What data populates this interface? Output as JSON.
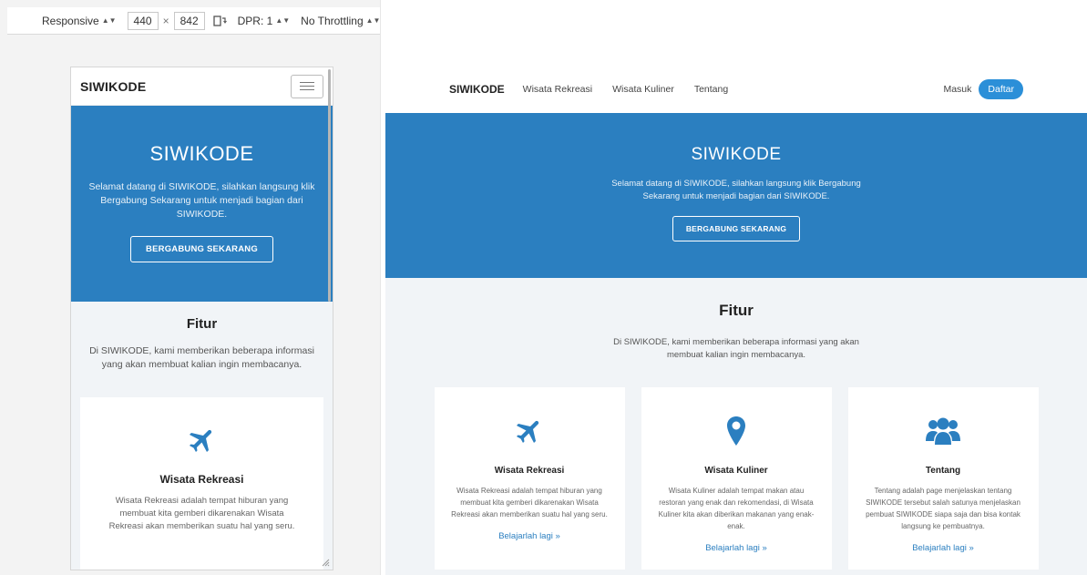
{
  "devtools": {
    "device": "Responsive",
    "width": "440",
    "times": "×",
    "height": "842",
    "dpr_label": "DPR: 1",
    "throttling": "No Throttling"
  },
  "site": {
    "brand": "SIWIKODE",
    "nav_links": [
      "Wisata Rekreasi",
      "Wisata Kuliner",
      "Tentang"
    ],
    "login": "Masuk",
    "register": "Daftar",
    "hero": {
      "title": "SIWIKODE",
      "text": "Selamat datang di SIWIKODE, silahkan langsung klik Bergabung Sekarang untuk menjadi bagian dari SIWIKODE.",
      "button": "BERGABUNG SEKARANG"
    },
    "features": {
      "title": "Fitur",
      "text": "Di SIWIKODE, kami memberikan beberapa informasi yang akan membuat kalian ingin membacanya."
    },
    "cards": [
      {
        "icon": "plane-icon",
        "title": "Wisata Rekreasi",
        "text": "Wisata Rekreasi adalah tempat hiburan yang membuat kita gemberi dikarenakan Wisata Rekreasi akan memberikan suatu hal yang seru.",
        "link": "Belajarlah lagi »"
      },
      {
        "icon": "map-marker-icon",
        "title": "Wisata Kuliner",
        "text": "Wisata Kuliner adalah tempat makan atau restoran yang enak dan rekomendasi, di Wisata Kuliner kita akan diberikan makanan yang enak-enak.",
        "link": "Belajarlah lagi »"
      },
      {
        "icon": "users-icon",
        "title": "Tentang",
        "text": "Tentang adalah page menjelaskan tentang SIWIKODE tersebut salah satunya menjelaskan pembuat SIWIKODE siapa saja dan bisa kontak langsung ke pembuatnya.",
        "link": "Belajarlah lagi »"
      }
    ]
  },
  "colors": {
    "primary": "#2b7fc0",
    "button": "#2b8fd8",
    "section_bg": "#f1f4f7"
  }
}
